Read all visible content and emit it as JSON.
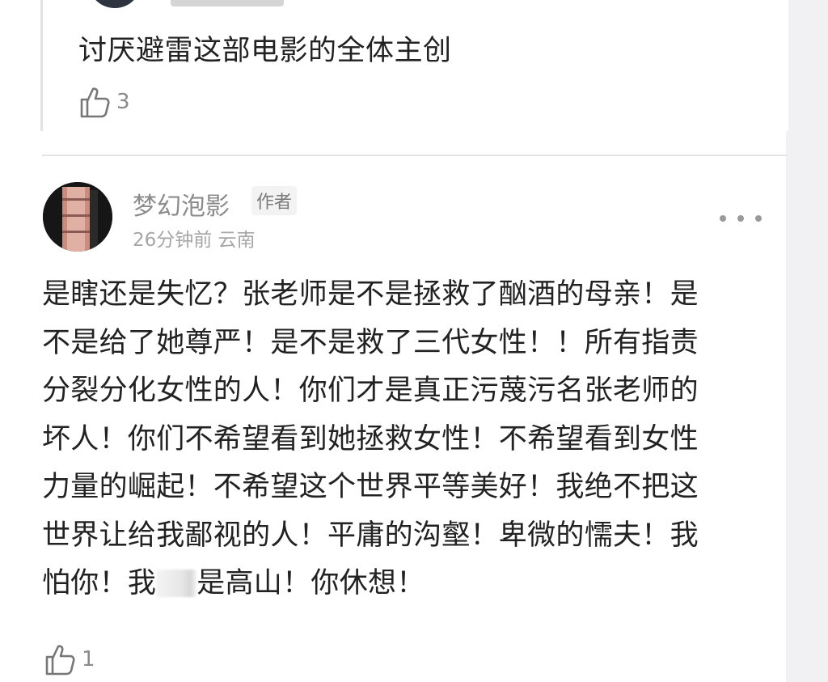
{
  "reply": {
    "text": "讨厌避雷这部电影的全体主创",
    "like_icon": "thumbs-up-icon",
    "like_count": "3"
  },
  "comment": {
    "username": "梦幻泡影",
    "badge": "作者",
    "meta": "26分钟前 云南",
    "more_icon": "more-dots-icon",
    "lines": [
      "是瞎还是失忆？张老师是不是拯救了酗酒的母亲！是",
      "不是给了她尊严！是不是救了三代女性！！所有指责",
      "分裂分化女性的人！你们才是真正污蔑污名张老师的",
      "坏人！你们不希望看到她拯救女性！不希望看到女性",
      "力量的崛起！不希望这个世界平等美好！我绝不把这",
      "世界让给我鄙视的人！平庸的沟壑！卑微的懦夫！我"
    ],
    "last_line_before": "怕你！我",
    "last_line_after": "是高山！你休想！",
    "like_icon": "thumbs-up-icon",
    "like_count": "1"
  },
  "colors": {
    "text": "#222222",
    "muted": "#8b8b8b",
    "gutter": "#f1f1f3"
  }
}
